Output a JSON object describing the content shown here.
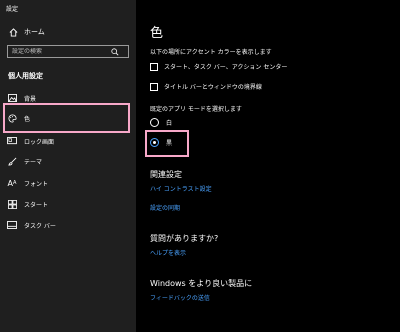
{
  "window": {
    "title": "設定"
  },
  "sidebar": {
    "home_label": "ホーム",
    "search_placeholder": "設定の検索",
    "section_label": "個人用設定",
    "items": [
      {
        "label": "背景",
        "icon": "picture-icon"
      },
      {
        "label": "色",
        "icon": "palette-icon",
        "selected": true
      },
      {
        "label": "ロック画面",
        "icon": "lock-screen-icon"
      },
      {
        "label": "テーマ",
        "icon": "brush-icon"
      },
      {
        "label": "フォント",
        "icon": "font-icon"
      },
      {
        "label": "スタート",
        "icon": "start-icon"
      },
      {
        "label": "タスク バー",
        "icon": "taskbar-icon"
      }
    ]
  },
  "main": {
    "title": "色",
    "accent_prompt": "以下の場所にアクセント カラーを表示します",
    "accent_options": [
      {
        "label": "スタート、タスク バー、アクション センター",
        "checked": false
      },
      {
        "label": "タイトル バーとウィンドウの境界線",
        "checked": false
      }
    ],
    "mode_prompt": "既定のアプリ モードを選択します",
    "mode_options": [
      {
        "label": "白",
        "selected": false
      },
      {
        "label": "黒",
        "selected": true
      }
    ],
    "related_heading": "関連設定",
    "related_links": [
      "ハイ コントラスト設定",
      "設定の同期"
    ],
    "question_heading": "質問がありますか?",
    "help_link": "ヘルプを表示",
    "improve_heading": "Windows をより良い製品に",
    "feedback_link": "フィードバックの送信"
  },
  "colors": {
    "accent": "#4aa3ff",
    "highlight": "#f7a8c9",
    "sidebar_bg": "#1f1f1f",
    "main_bg": "#000000"
  }
}
